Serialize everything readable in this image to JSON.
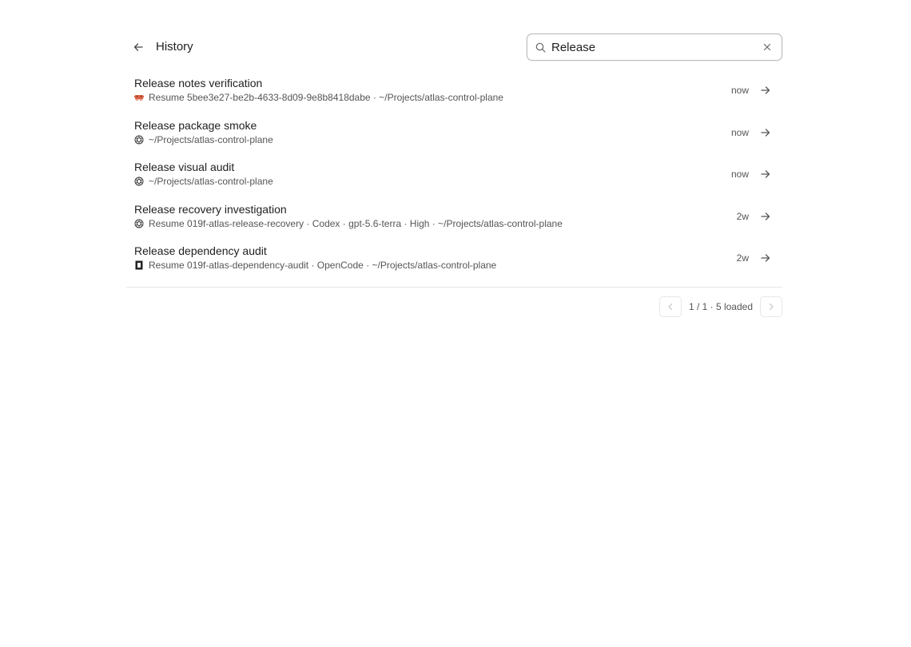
{
  "header": {
    "title": "History",
    "back_icon": "arrow-left-icon"
  },
  "search": {
    "value": "Release",
    "placeholder": "",
    "icon": "search-icon",
    "clear_icon": "close-icon"
  },
  "rows": [
    {
      "title": "Release notes verification",
      "subtitle": "Resume 5bee3e27-be2b-4633-8d09-9e8b8418dabe · ~/Projects/atlas-control-plane",
      "agent_icon": "pixel-critter-icon",
      "time": "now"
    },
    {
      "title": "Release package smoke",
      "subtitle": "~/Projects/atlas-control-plane",
      "agent_icon": "openai-knot-icon",
      "time": "now"
    },
    {
      "title": "Release visual audit",
      "subtitle": "~/Projects/atlas-control-plane",
      "agent_icon": "openai-knot-icon",
      "time": "now"
    },
    {
      "title": "Release recovery investigation",
      "subtitle": "Resume 019f-atlas-release-recovery · Codex · gpt-5.6-terra · High · ~/Projects/atlas-control-plane",
      "agent_icon": "openai-knot-icon",
      "time": "2w"
    },
    {
      "title": "Release dependency audit",
      "subtitle": "Resume 019f-atlas-dependency-audit · OpenCode · ~/Projects/atlas-control-plane",
      "agent_icon": "opencode-square-icon",
      "time": "2w"
    }
  ],
  "pagination": {
    "text": "1 / 1 · 5 loaded",
    "prev_icon": "chevron-left-icon",
    "next_icon": "chevron-right-icon"
  },
  "colors": {
    "critter": "#d95f43",
    "text": "#1f1f1f",
    "muted": "#555555"
  }
}
